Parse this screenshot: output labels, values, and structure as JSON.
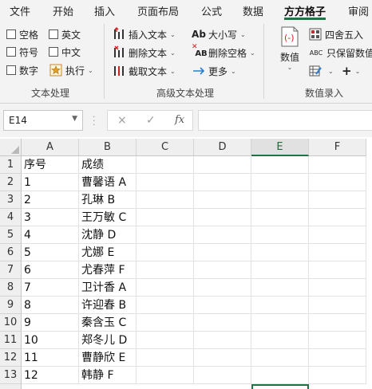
{
  "tabs": [
    {
      "label": "文件",
      "active": false
    },
    {
      "label": "开始",
      "active": false
    },
    {
      "label": "插入",
      "active": false
    },
    {
      "label": "页面布局",
      "active": false
    },
    {
      "label": "公式",
      "active": false
    },
    {
      "label": "数据",
      "active": false
    },
    {
      "label": "方方格子",
      "active": true
    },
    {
      "label": "审阅",
      "active": false
    }
  ],
  "ribbon": {
    "text_group": {
      "label": "文本处理",
      "checkboxes": [
        "空格",
        "英文",
        "符号",
        "中文",
        "数字"
      ],
      "execute_label": "执行"
    },
    "advanced_group": {
      "label": "高级文本处理",
      "insert_text": "插入文本",
      "delete_text": "删除文本",
      "extract_text": "截取文本",
      "case_label": "大小写",
      "case_icon_text": "Ab",
      "remove_space": "删除空格",
      "remove_space_icon_text": "AB",
      "more": "更多"
    },
    "number_group": {
      "label": "数值录入",
      "value_button": "数值",
      "round": "四舍五入",
      "keep_values": "只保留数值",
      "keep_values_icon_text": "ABC"
    }
  },
  "formula_bar": {
    "name_box": "E14",
    "cancel_icon": "×",
    "enter_icon": "✓",
    "fx_label": "fx",
    "formula": ""
  },
  "grid": {
    "columns": [
      "A",
      "B",
      "C",
      "D",
      "E",
      "F"
    ],
    "selected_column": "E",
    "selected_cell": "E14",
    "row_numbers": [
      "1",
      "2",
      "3",
      "4",
      "5",
      "6",
      "7",
      "8",
      "9",
      "10",
      "11",
      "12",
      "13"
    ],
    "rows": [
      [
        "序号",
        "成绩"
      ],
      [
        "1",
        "曹馨语 A"
      ],
      [
        "2",
        "孔琳 B"
      ],
      [
        "3",
        "王万敏 C"
      ],
      [
        "4",
        "沈静 D"
      ],
      [
        "5",
        "尤娜 E"
      ],
      [
        "6",
        "尤春萍 F"
      ],
      [
        "7",
        "卫计香 A"
      ],
      [
        "8",
        "许迎春 B"
      ],
      [
        "9",
        "秦含玉 C"
      ],
      [
        "10",
        "郑冬儿 D"
      ],
      [
        "11",
        "曹静欣 E"
      ],
      [
        "12",
        "韩静 F"
      ]
    ]
  },
  "colors": {
    "accent": "#217346",
    "ribbon_bg": "#f3f3f3",
    "header_bg": "#efefef"
  }
}
